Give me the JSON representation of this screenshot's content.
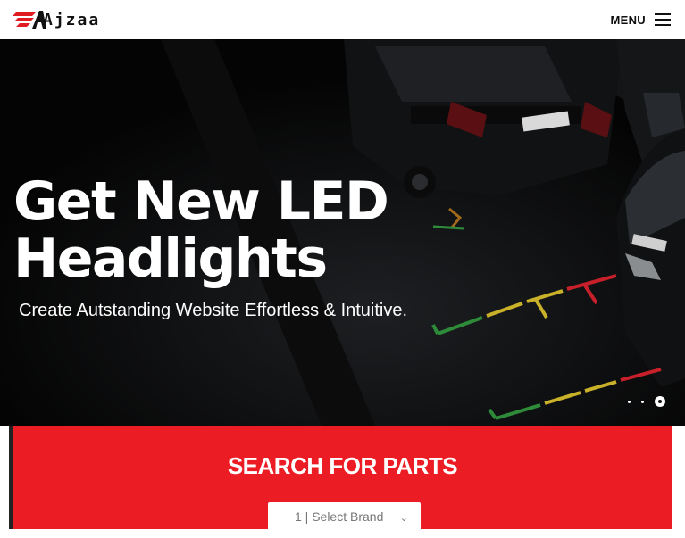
{
  "header": {
    "logo_text": "Ajzaa",
    "menu_label": "MENU"
  },
  "hero": {
    "title_line1": "Get New LED",
    "title_line2": "Headlights",
    "subtitle": "Create Autstanding Website Effortless & Intuitive.",
    "slides": 3,
    "active_slide": 3
  },
  "search": {
    "title": "SEARCH FOR PARTS",
    "brand_select": "1 | Select Brand"
  },
  "colors": {
    "accent": "#ec1c24",
    "header_bg": "#ffffff",
    "hero_bg": "#050505"
  }
}
